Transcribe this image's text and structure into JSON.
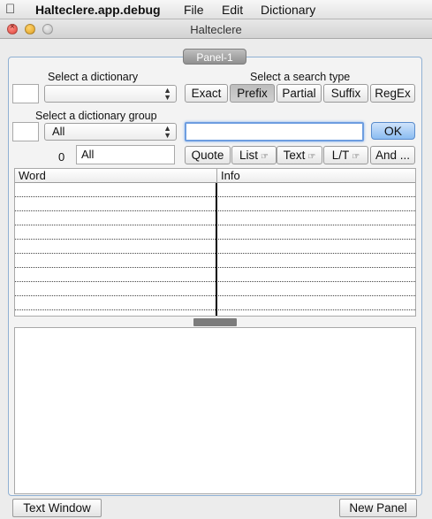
{
  "menubar": {
    "app_name": "Halteclere.app.debug",
    "items": [
      "File",
      "Edit",
      "Dictionary"
    ]
  },
  "window": {
    "title": "Halteclere"
  },
  "panel": {
    "tab_label": "Panel-1"
  },
  "dictionary": {
    "label": "Select a dictionary",
    "selected": ""
  },
  "group": {
    "label": "Select a dictionary group",
    "selected": "All"
  },
  "search_type": {
    "label": "Select a search type",
    "buttons": [
      "Exact",
      "Prefix",
      "Partial",
      "Suffix",
      "RegEx"
    ],
    "active": "Prefix"
  },
  "search": {
    "value": "",
    "ok_label": "OK"
  },
  "filter": {
    "count": "0",
    "value": "All"
  },
  "actions": {
    "quote": "Quote",
    "list": "List",
    "text": "Text",
    "lt": "L/T",
    "and": "And ..."
  },
  "table": {
    "columns": [
      "Word",
      "Info"
    ],
    "rows": []
  },
  "footer": {
    "text_window": "Text Window",
    "new_panel": "New Panel"
  }
}
